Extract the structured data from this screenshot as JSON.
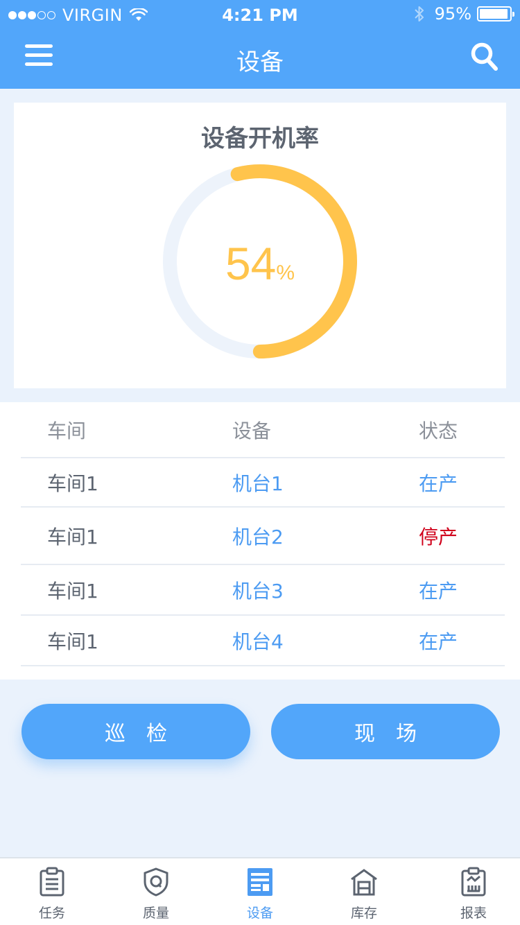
{
  "status_bar": {
    "carrier": "VIRGIN",
    "time": "4:21 PM",
    "battery": "95%",
    "battery_level": 0.95
  },
  "nav": {
    "title": "设备",
    "menu_icon": "menu-icon",
    "search_icon": "search-icon"
  },
  "rate_card": {
    "title": "设备开机率",
    "value": "54",
    "unit": "%",
    "fraction": 0.54,
    "colors": {
      "progress": "#ffc44c",
      "track": "#edf3fb"
    }
  },
  "table": {
    "headers": [
      "车间",
      "设备",
      "状态"
    ],
    "rows": [
      {
        "workshop": "车间1",
        "device": "机台1",
        "status": "在产",
        "running": true
      },
      {
        "workshop": "车间1",
        "device": "机台2",
        "status": "停产",
        "running": false
      },
      {
        "workshop": "车间1",
        "device": "机台3",
        "status": "在产",
        "running": true
      },
      {
        "workshop": "车间1",
        "device": "机台4",
        "status": "在产",
        "running": true
      }
    ]
  },
  "actions": {
    "patrol": "巡检",
    "site": "现场"
  },
  "tabs": [
    {
      "label": "任务",
      "icon": "clipboard-list-icon",
      "active": false
    },
    {
      "label": "质量",
      "icon": "shield-q-icon",
      "active": false
    },
    {
      "label": "设备",
      "icon": "equipment-icon",
      "active": true
    },
    {
      "label": "库存",
      "icon": "warehouse-icon",
      "active": false
    },
    {
      "label": "报表",
      "icon": "report-clipboard-icon",
      "active": false
    }
  ],
  "colors": {
    "primary": "#52a6fa",
    "background": "#eaf2fc",
    "stopped": "#d0011b"
  }
}
